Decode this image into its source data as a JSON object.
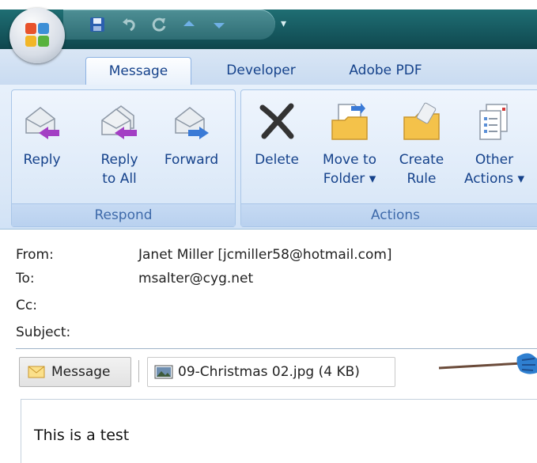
{
  "ribbon": {
    "tabs": [
      {
        "label": "Message",
        "active": true
      },
      {
        "label": "Developer",
        "active": false
      },
      {
        "label": "Adobe PDF",
        "active": false
      }
    ],
    "groups": {
      "respond": {
        "label": "Respond",
        "buttons": [
          {
            "line1": "Reply",
            "line2": "",
            "icon": "reply-icon"
          },
          {
            "line1": "Reply",
            "line2": "to All",
            "icon": "reply-all-icon"
          },
          {
            "line1": "Forward",
            "line2": "",
            "icon": "forward-icon"
          }
        ]
      },
      "actions": {
        "label": "Actions",
        "buttons": [
          {
            "line1": "Delete",
            "line2": "",
            "icon": "delete-icon"
          },
          {
            "line1": "Move to",
            "line2": "Folder ▾",
            "icon": "move-to-folder-icon"
          },
          {
            "line1": "Create",
            "line2": "Rule",
            "icon": "create-rule-icon"
          },
          {
            "line1": "Other",
            "line2": "Actions ▾",
            "icon": "other-actions-icon"
          }
        ]
      }
    }
  },
  "header": {
    "from_label": "From:",
    "from_value": "Janet Miller [jcmiller58@hotmail.com]",
    "to_label": "To:",
    "to_value": "msalter@cyg.net",
    "cc_label": "Cc:",
    "cc_value": "",
    "subject_label": "Subject:",
    "subject_value": ""
  },
  "attachments": {
    "message_label": "Message",
    "file_label": "09-Christmas 02.jpg (4 KB)"
  },
  "body": {
    "text": "This is a test"
  },
  "colors": {
    "ribbon_text": "#15428b",
    "title_bar": "#1f6e73",
    "group_label": "#3e6aaa"
  }
}
